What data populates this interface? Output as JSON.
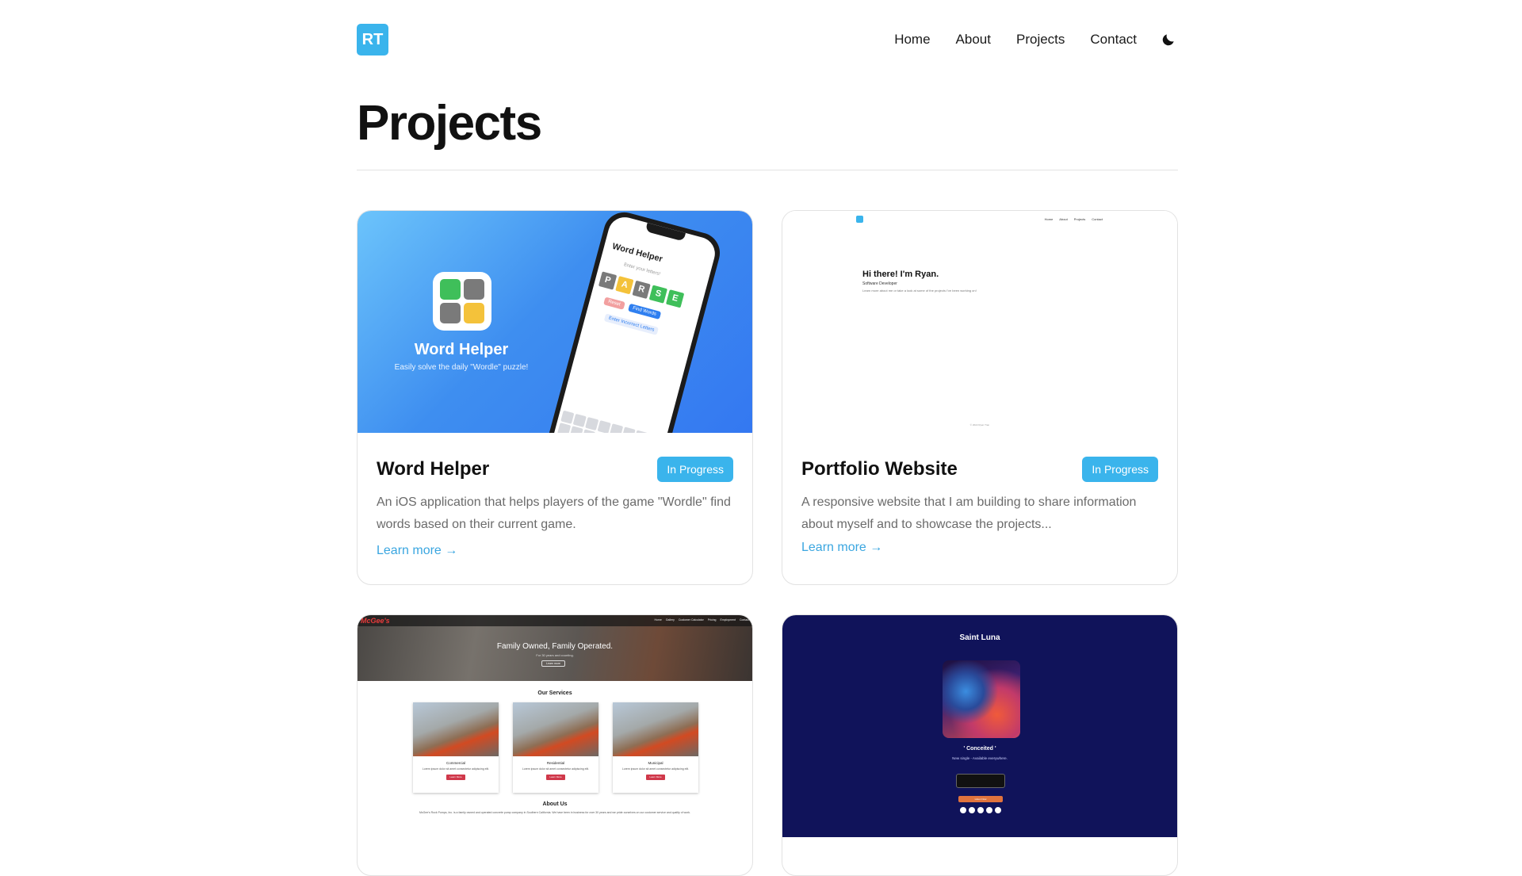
{
  "header": {
    "logo": "RT",
    "nav": [
      "Home",
      "About",
      "Projects",
      "Contact"
    ],
    "theme_icon": "moon-icon"
  },
  "page": {
    "title": "Projects"
  },
  "projects": [
    {
      "title": "Word Helper",
      "status": "In Progress",
      "description": "An iOS application that helps players of the game \"Wordle\" find words based on their current game.",
      "link": "Learn more →",
      "image": {
        "app_name": "Word Helper",
        "tagline": "Easily solve the daily \"Wordle\" puzzle!",
        "phone_title": "Word Helper",
        "phone_hint": "Enter your letters!",
        "tiles": [
          "P",
          "A",
          "R",
          "S",
          "E"
        ],
        "reset": "Reset",
        "find": "Find Words",
        "incorrect": "Enter Incorrect Letters"
      }
    },
    {
      "title": "Portfolio Website",
      "status": "In Progress",
      "description": "A responsive website that I am building to share information about myself and to showcase the projects...",
      "link": "Learn more →",
      "image": {
        "nav": [
          "Home",
          "About",
          "Projects",
          "Contact"
        ],
        "hello": "Hi there! I'm Ryan.",
        "role": "Software Developer",
        "text": "Learn more about me or take a look at some of the projects I've been working on!",
        "footer": "© 2022 Ryan Tran"
      }
    },
    {
      "image": {
        "brand": "McGee's",
        "nav": [
          "Home",
          "Gallery",
          "Customer Calculator",
          "Pricing",
          "Employment",
          "Contact"
        ],
        "tagline": "Family Owned, Family Operated.",
        "subtag": "For 30 years and counting.",
        "hero_button": "Learn more",
        "services_heading": "Our Services",
        "services": [
          {
            "title": "Commercial",
            "text": "Lorem ipsum dolor sit amet consectetur adipiscing elit.",
            "button": "Learn More"
          },
          {
            "title": "Residential",
            "text": "Lorem ipsum dolor sit amet consectetur adipiscing elit.",
            "button": "Learn More"
          },
          {
            "title": "Municipal",
            "text": "Lorem ipsum dolor sit amet consectetur adipiscing elit.",
            "button": "Learn More"
          }
        ],
        "about_heading": "About Us",
        "about_text": "McGee's Rock Pumps, Inc. is a family owned and operated concrete pump company in Southern California. We have been in business for over 30 years and we pride ourselves on our customer service and quality of work."
      }
    },
    {
      "image": {
        "artist": "Saint Luna",
        "song": "' Conceited '",
        "sub": "New single - Available everywhere.",
        "button": "Listen Now"
      }
    }
  ]
}
